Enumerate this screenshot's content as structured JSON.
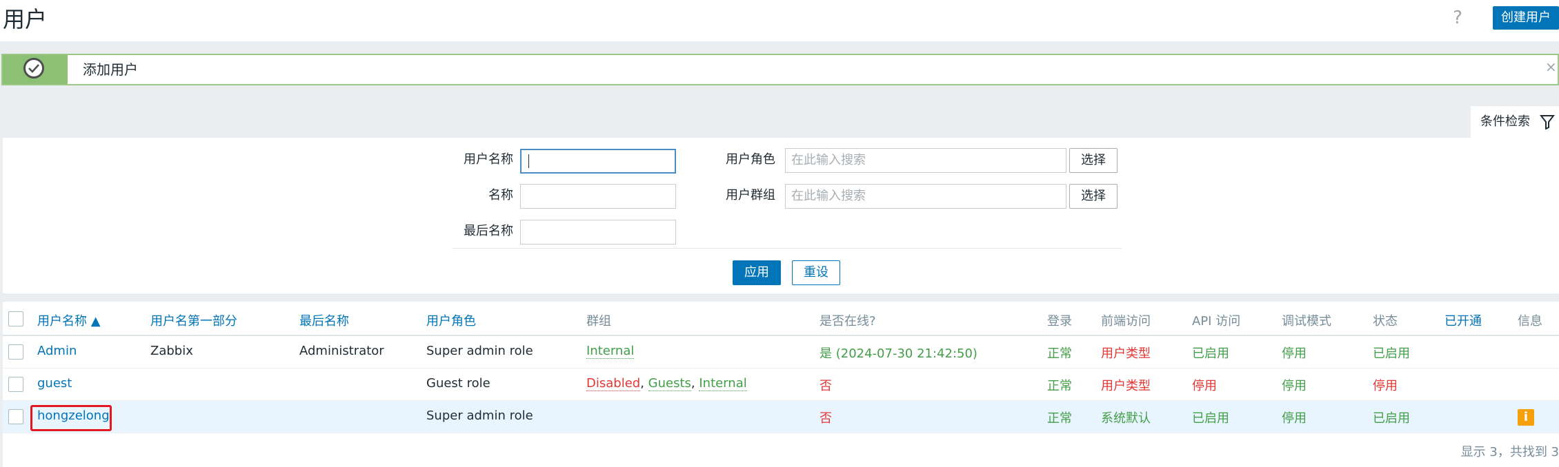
{
  "header": {
    "title": "用户",
    "help_icon": "question-mark-icon",
    "create_button": "创建用户"
  },
  "message": {
    "text": "添加用户",
    "status": "success",
    "close_symbol": "×"
  },
  "filter": {
    "tab_label": "条件检索",
    "fields": {
      "username_label": "用户名称",
      "username_value": "",
      "name_label": "名称",
      "name_value": "",
      "lastname_label": "最后名称",
      "lastname_value": "",
      "role_label": "用户角色",
      "role_placeholder": "在此输入搜索",
      "group_label": "用户群组",
      "group_placeholder": "在此输入搜索",
      "select_label": "选择"
    },
    "apply_button": "应用",
    "reset_button": "重设"
  },
  "table": {
    "headers": {
      "username": "用户名称 ▲",
      "name": "用户名第一部分",
      "surname": "最后名称",
      "role": "用户角色",
      "groups": "群组",
      "online": "是否在线?",
      "login": "登录",
      "frontend": "前端访问",
      "api": "API 访问",
      "debug": "调试模式",
      "status": "状态",
      "provisioned": "已开通",
      "info": "信息"
    },
    "rows": [
      {
        "username": "Admin",
        "name": "Zabbix",
        "surname": "Administrator",
        "role": "Super admin role",
        "groups": [
          {
            "text": "Internal",
            "color": "green"
          }
        ],
        "online": "是 (2024-07-30 21:42:50)",
        "login": "正常",
        "frontend": "用户类型",
        "api": "已启用",
        "debug": "停用",
        "status": "已启用",
        "info": ""
      },
      {
        "username": "guest",
        "name": "",
        "surname": "",
        "role": "Guest role",
        "groups": [
          {
            "text": "Disabled",
            "color": "red"
          },
          {
            "text": "Guests",
            "color": "green"
          },
          {
            "text": "Internal",
            "color": "green"
          }
        ],
        "online": "否",
        "login": "正常",
        "frontend": "用户类型",
        "api": "停用",
        "debug": "停用",
        "status": "停用",
        "info": ""
      },
      {
        "username": "hongzelong",
        "name": "",
        "surname": "",
        "role": "Super admin role",
        "groups": [],
        "online": "否",
        "login": "正常",
        "frontend": "系统默认",
        "api": "已启用",
        "debug": "停用",
        "status": "已启用",
        "info": "i"
      }
    ],
    "footer": "显示 3，共找到 3"
  },
  "colors": {
    "accent": "#0275b8",
    "success": "#8cc075",
    "green": "#429e47",
    "red": "#e33734",
    "highlight": "#e4171e",
    "info": "#f3a00c"
  }
}
